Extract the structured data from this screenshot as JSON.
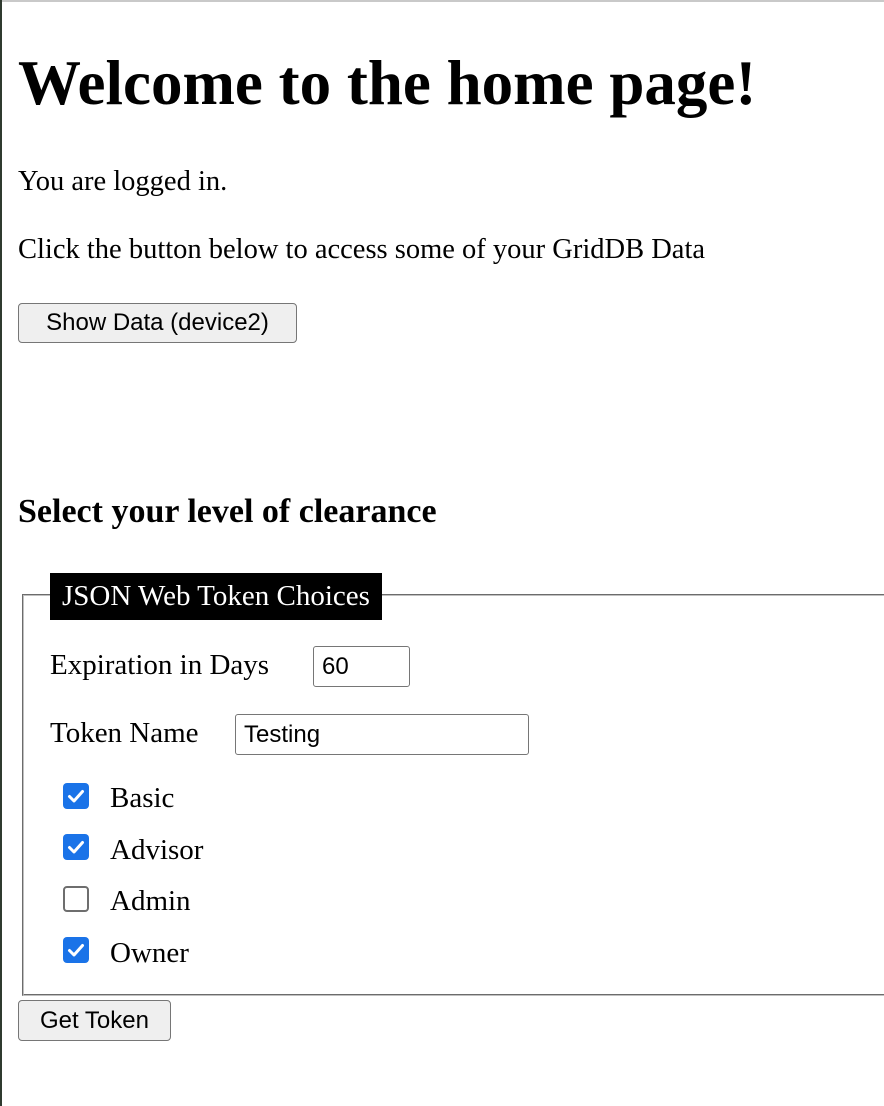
{
  "header": {
    "title": "Welcome to the home page!"
  },
  "status_text": "You are logged in.",
  "instruction_text": "Click the button below to access some of your GridDB Data",
  "show_data_button": "Show Data (device2)",
  "clearance": {
    "heading": "Select your level of clearance",
    "legend": "JSON Web Token Choices",
    "expiration": {
      "label": "Expiration in Days",
      "value": "60"
    },
    "token_name": {
      "label": "Token Name",
      "value": "Testing"
    },
    "roles": [
      {
        "label": "Basic",
        "checked": true
      },
      {
        "label": "Advisor",
        "checked": true
      },
      {
        "label": "Admin",
        "checked": false
      },
      {
        "label": "Owner",
        "checked": true
      }
    ],
    "get_token_button": "Get Token"
  },
  "colors": {
    "checkbox_accent": "#1a73e8",
    "legend_bg": "#000000",
    "legend_text": "#ffffff"
  }
}
